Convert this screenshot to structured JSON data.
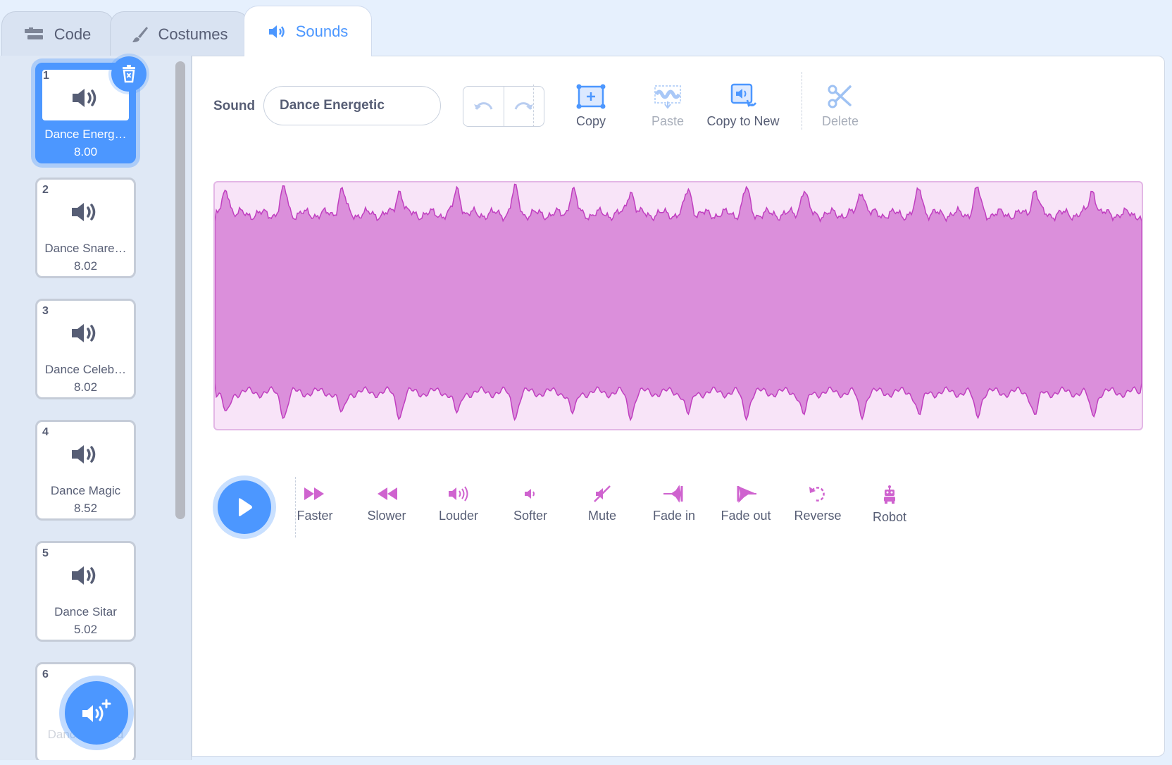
{
  "tabs": [
    {
      "label": "Code",
      "icon": "code-icon"
    },
    {
      "label": "Costumes",
      "icon": "brush-icon"
    },
    {
      "label": "Sounds",
      "icon": "speaker-icon"
    }
  ],
  "sounds": [
    {
      "num": "1",
      "name": "Dance Energ…",
      "duration": "8.00"
    },
    {
      "num": "2",
      "name": "Dance Snare…",
      "duration": "8.02"
    },
    {
      "num": "3",
      "name": "Dance Celeb…",
      "duration": "8.02"
    },
    {
      "num": "4",
      "name": "Dance Magic",
      "duration": "8.52"
    },
    {
      "num": "5",
      "name": "Dance Sitar",
      "duration": "5.02"
    },
    {
      "num": "6",
      "name": "Dance Around",
      "duration": ""
    }
  ],
  "editor": {
    "sound_label": "Sound",
    "sound_name": "Dance Energetic",
    "tools": {
      "copy": "Copy",
      "paste": "Paste",
      "copy_to_new": "Copy to New",
      "delete": "Delete"
    },
    "effects": [
      "Faster",
      "Slower",
      "Louder",
      "Softer",
      "Mute",
      "Fade in",
      "Fade out",
      "Reverse",
      "Robot"
    ]
  },
  "colors": {
    "accent": "#4c97ff",
    "wave_fill": "#db8fdb",
    "wave_stroke": "#c03fc0",
    "wave_bg": "#f8e4f8",
    "effect_icon": "#cf63cf"
  }
}
